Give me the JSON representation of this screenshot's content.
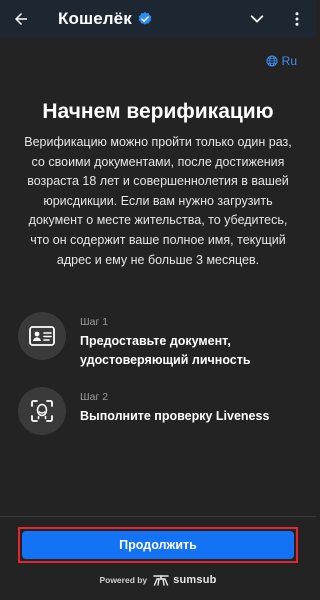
{
  "appbar": {
    "title": "Кошелёк",
    "icons": {
      "back": "arrow-left-icon",
      "verified": "verified-badge-icon",
      "dropdown": "chevron-down-icon",
      "more": "more-vert-icon"
    }
  },
  "language": {
    "label": "Ru",
    "icon": "globe-icon"
  },
  "main": {
    "heading": "Начнем верификацию",
    "description": "Верификацию можно пройти только один раз, со своими документами, после достижения возраста 18 лет и совершеннолетия в вашей юрисдикции. Если вам нужно загрузить документ о месте жительства, то убедитесь, что он содержит ваше полное имя, текущий адрес и ему не больше 3 месяцев."
  },
  "steps": [
    {
      "label": "Шаг 1",
      "text": "Предоставьте документ, удостоверяющий личность",
      "icon": "id-card-icon"
    },
    {
      "label": "Шаг 2",
      "text": "Выполните проверку Liveness",
      "icon": "face-scan-icon"
    }
  ],
  "cta": {
    "label": "Продолжить"
  },
  "footer": {
    "powered": "Powered by",
    "brand": "sumsub"
  },
  "colors": {
    "accent": "#1472f5",
    "highlight": "#e5242b",
    "appbar": "#1d2731",
    "background": "#232323"
  }
}
